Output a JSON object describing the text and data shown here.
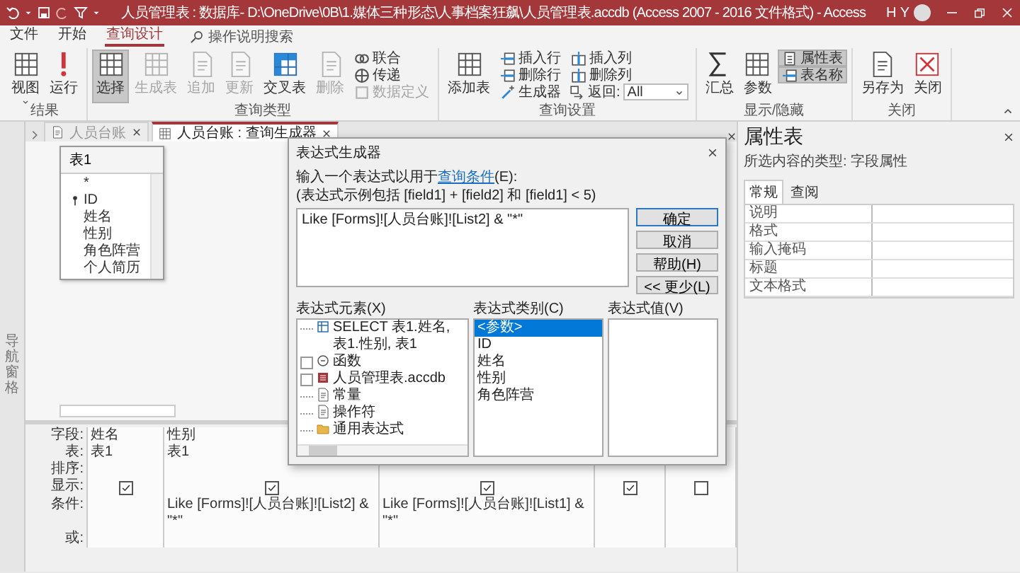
{
  "titlebar": {
    "title": "人员管理表 : 数据库- D:\\OneDrive\\0B\\1.媒体三种形态\\人事档案狂飙\\人员管理表.accdb (Access 2007 - 2016 文件格式) - Access",
    "user": "H Y"
  },
  "menu": {
    "tabs": [
      {
        "label": "文件",
        "selected": false
      },
      {
        "label": "开始",
        "selected": false
      },
      {
        "label": "查询设计",
        "selected": true
      }
    ],
    "search": {
      "placeholder": "操作说明搜索"
    }
  },
  "ribbon": {
    "groups": [
      {
        "label": "结果",
        "items": [
          {
            "kind": "large",
            "label": "视图",
            "on": false,
            "disabled": false,
            "dropdown": true
          },
          {
            "kind": "large",
            "label": "运行",
            "on": false,
            "disabled": false,
            "dropdown": false
          }
        ]
      },
      {
        "label": "查询类型",
        "items": [
          {
            "kind": "large",
            "label": "选择",
            "on": true,
            "disabled": false,
            "dropdown": false
          },
          {
            "kind": "large",
            "label": "生成表",
            "on": false,
            "disabled": true,
            "dropdown": false
          },
          {
            "kind": "large",
            "label": "追加",
            "on": false,
            "disabled": true,
            "dropdown": false
          },
          {
            "kind": "large",
            "label": "更新",
            "on": false,
            "disabled": true,
            "dropdown": false
          },
          {
            "kind": "large",
            "label": "交叉表",
            "on": false,
            "disabled": false,
            "dropdown": false
          },
          {
            "kind": "large",
            "label": "删除",
            "on": false,
            "disabled": true,
            "dropdown": false
          },
          {
            "kind": "stack",
            "buttons": [
              {
                "kind": "button",
                "label": "联合",
                "on": false,
                "disabled": false
              },
              {
                "kind": "button",
                "label": "传递",
                "on": false,
                "disabled": false
              },
              {
                "kind": "button",
                "label": "数据定义",
                "on": false,
                "disabled": true
              }
            ]
          }
        ]
      },
      {
        "label": "查询设置",
        "items": [
          {
            "kind": "large",
            "label": "添加表",
            "on": false,
            "disabled": false,
            "dropdown": false
          },
          {
            "kind": "stack",
            "buttons": [
              {
                "kind": "button",
                "label": "插入行",
                "on": false,
                "disabled": false
              },
              {
                "kind": "button",
                "label": "删除行",
                "on": false,
                "disabled": false
              },
              {
                "kind": "button",
                "label": "生成器",
                "on": false,
                "disabled": false
              }
            ]
          },
          {
            "kind": "stack",
            "buttons": [
              {
                "kind": "button",
                "label": "插入列",
                "on": false,
                "disabled": false
              },
              {
                "kind": "button",
                "label": "删除列",
                "on": false,
                "disabled": false
              },
              {
                "kind": "select",
                "label": "返回:",
                "value": "All"
              }
            ]
          }
        ]
      },
      {
        "label": "显示/隐藏",
        "items": [
          {
            "kind": "large",
            "label": "汇总",
            "on": false,
            "disabled": false,
            "dropdown": false
          },
          {
            "kind": "large",
            "label": "参数",
            "on": false,
            "disabled": false,
            "dropdown": false
          },
          {
            "kind": "stack",
            "buttons": [
              {
                "kind": "button",
                "label": "属性表",
                "on": true,
                "disabled": false
              },
              {
                "kind": "button",
                "label": "表名称",
                "on": true,
                "disabled": false
              }
            ]
          }
        ]
      },
      {
        "label": "关闭",
        "items": [
          {
            "kind": "large",
            "label": "另存为",
            "on": false,
            "disabled": false,
            "dropdown": false
          },
          {
            "kind": "large",
            "label": "关闭",
            "on": false,
            "disabled": false,
            "dropdown": false
          }
        ]
      }
    ]
  },
  "doc_tabs": [
    {
      "label": "人员台账",
      "selected": false
    },
    {
      "label": "人员台账 : 查询生成器",
      "selected": true
    }
  ],
  "nav_pane": {
    "label": "导航窗格"
  },
  "field_list": {
    "title": "表1",
    "fields": [
      {
        "name": "*",
        "key": false
      },
      {
        "name": "ID",
        "key": true
      },
      {
        "name": "姓名",
        "key": false
      },
      {
        "name": "性别",
        "key": false
      },
      {
        "name": "角色阵营",
        "key": false
      },
      {
        "name": "个人简历",
        "key": false
      }
    ]
  },
  "dialog": {
    "title": "表达式生成器",
    "prompt": "输入一个表达式以用于",
    "prompt_link": "查询条件",
    "prompt_after": "(E):",
    "example": "(表达式示例包括 [field1] + [field2] 和 [field1] < 5)",
    "expression": "Like [Forms]![人员台账]![List2] & \"*\"",
    "buttons": [
      {
        "label": "确定",
        "default": true
      },
      {
        "label": "取消",
        "default": false
      },
      {
        "label": "帮助(H)",
        "default": false
      },
      {
        "label": "<< 更少(L)",
        "default": false
      }
    ],
    "elements_label": "表达式元素(X)",
    "categories_label": "表达式类别(C)",
    "values_label": "表达式值(V)",
    "elements": [
      {
        "kind": "leaf",
        "label": "SELECT 表1.姓名, 表1.性别, 表1"
      },
      {
        "kind": "folder",
        "label": "函数"
      },
      {
        "kind": "folder",
        "label": "人员管理表.accdb"
      },
      {
        "kind": "leaf",
        "label": "常量"
      },
      {
        "kind": "leaf",
        "label": "操作符"
      },
      {
        "kind": "leaf",
        "label": "通用表达式"
      }
    ],
    "categories": [
      {
        "label": "<参数>",
        "selected": true
      },
      {
        "label": "ID",
        "selected": false
      },
      {
        "label": "姓名",
        "selected": false
      },
      {
        "label": "性别",
        "selected": false
      },
      {
        "label": "角色阵营",
        "selected": false
      }
    ]
  },
  "grid": {
    "row_labels": [
      "字段:",
      "表:",
      "排序:",
      "显示:",
      "条件:",
      "或:"
    ],
    "columns": [
      {
        "field": "姓名",
        "table": "表1",
        "show": true
      },
      {
        "field": "性别",
        "table": "表1",
        "show": true,
        "criteria": "Like [Forms]![人员台账]![List2] & \"*\""
      },
      {
        "show": true,
        "criteria": "Like [Forms]![人员台账]![List1] & \"*\""
      },
      {
        "show": true
      },
      {
        "show": false
      }
    ]
  },
  "property_sheet": {
    "title": "属性表",
    "subtitle": "所选内容的类型: 字段属性",
    "tabs": [
      {
        "label": "常规",
        "selected": true
      },
      {
        "label": "查阅",
        "selected": false
      }
    ],
    "rows": [
      {
        "label": "说明"
      },
      {
        "label": "格式"
      },
      {
        "label": "输入掩码"
      },
      {
        "label": "标题"
      },
      {
        "label": "文本格式"
      }
    ]
  }
}
